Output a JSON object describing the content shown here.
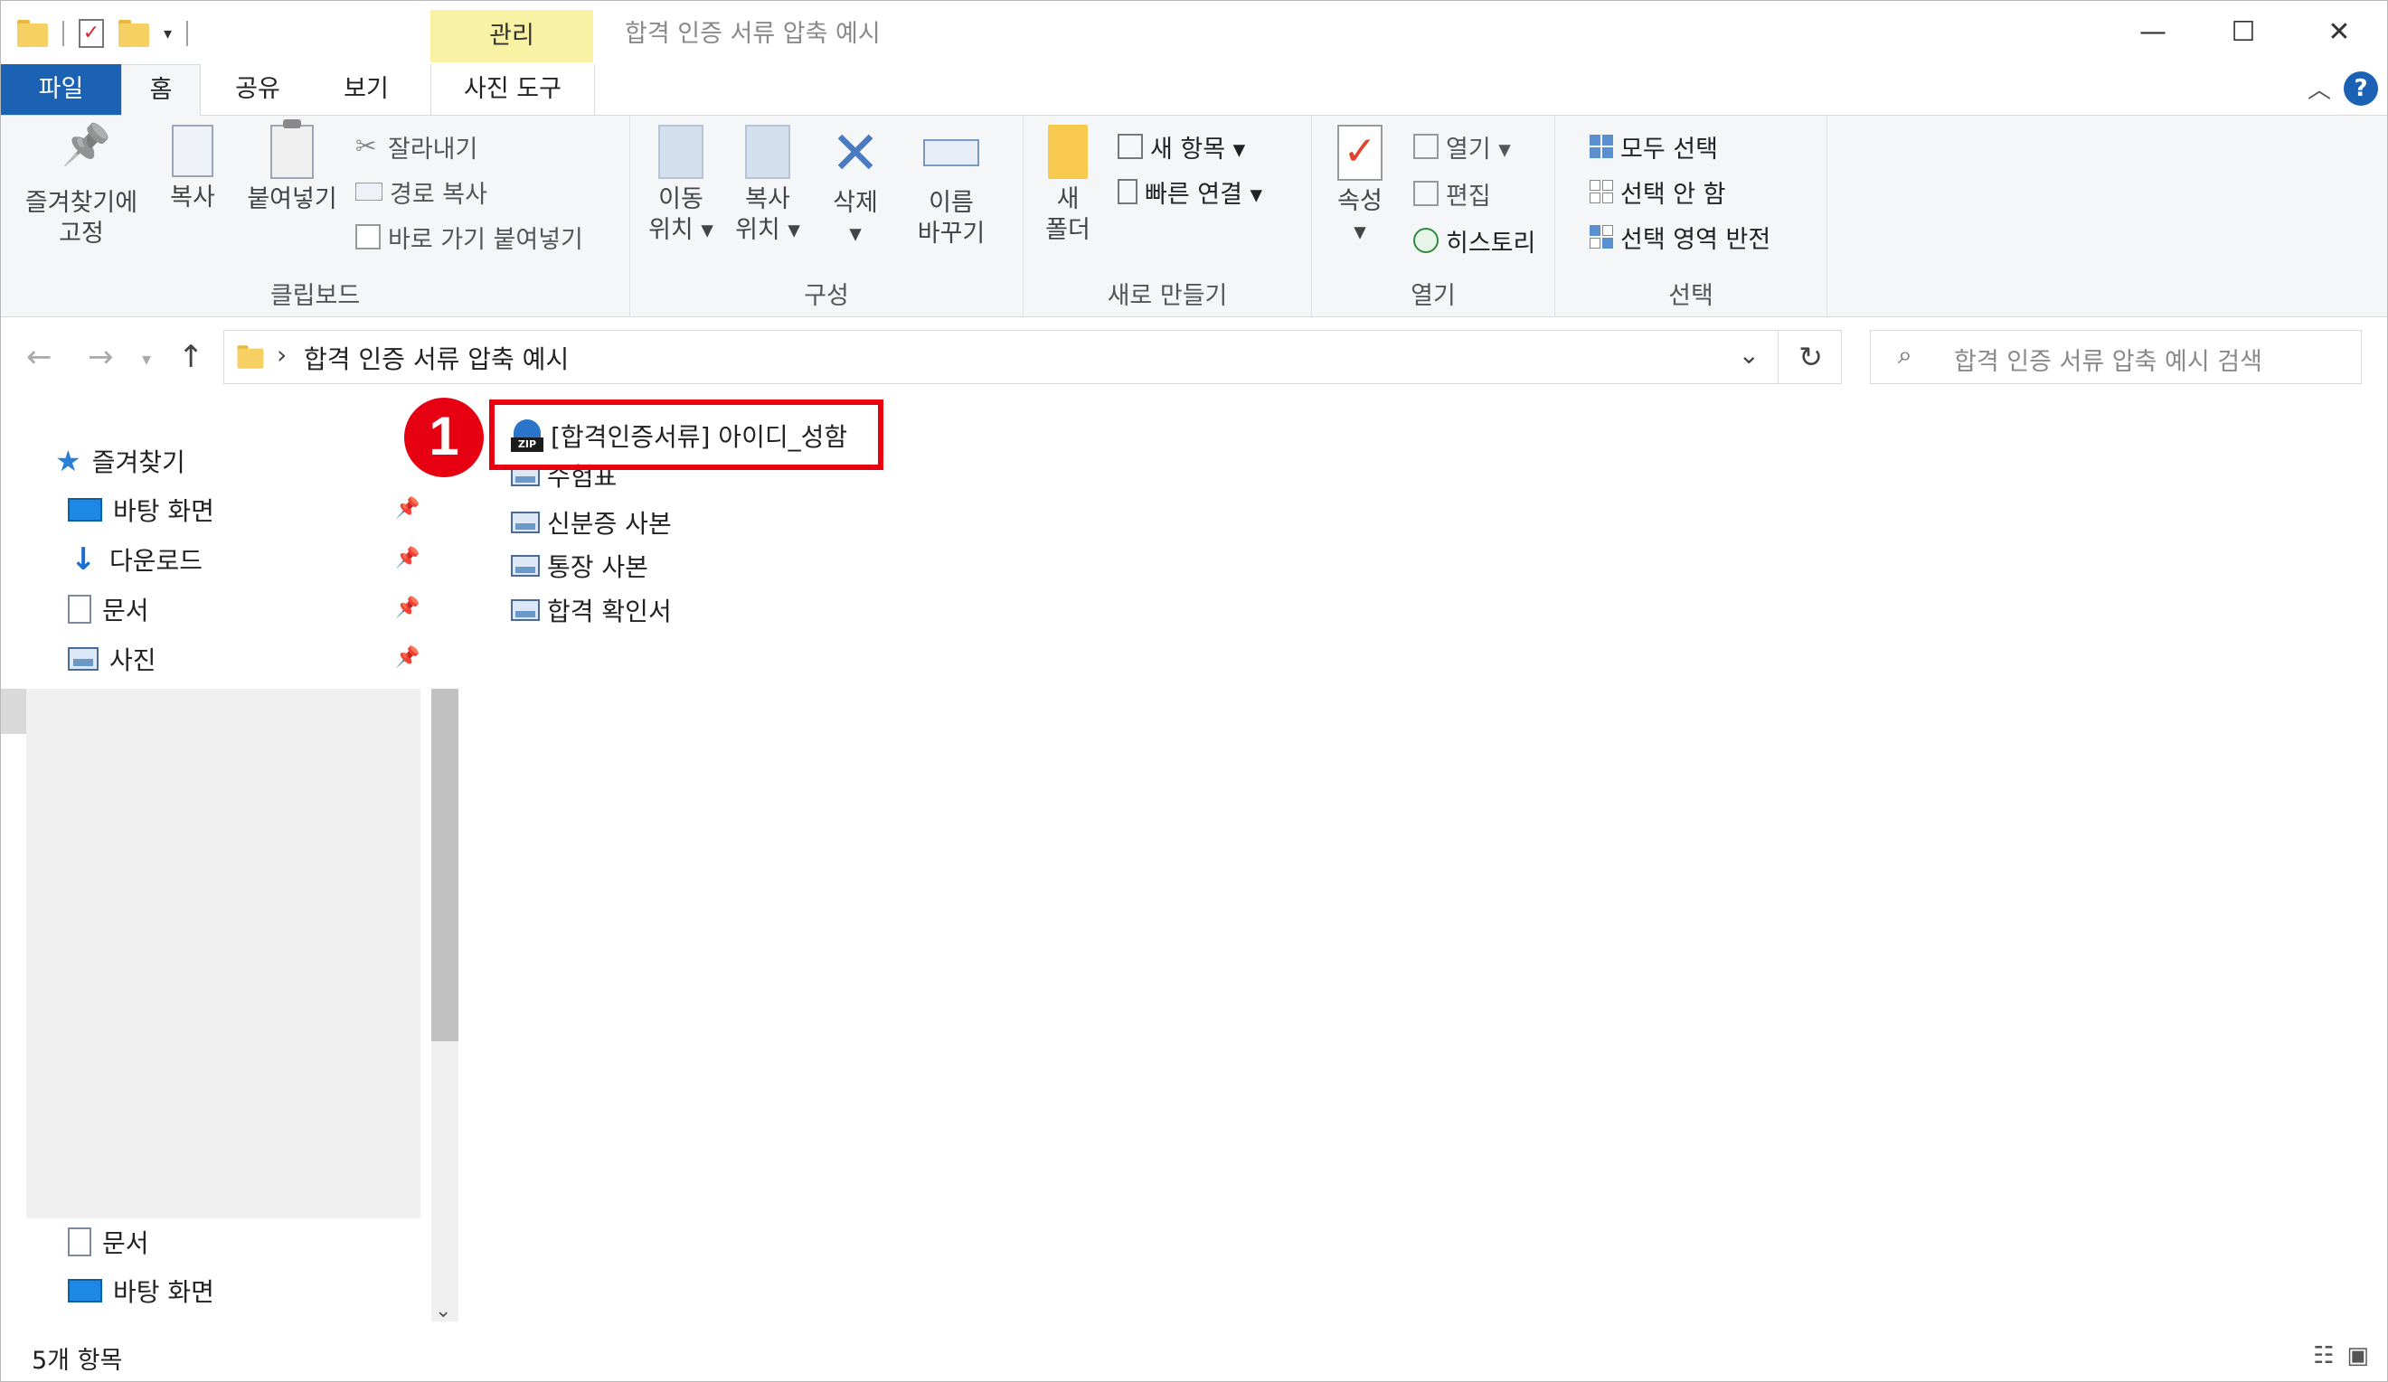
{
  "window": {
    "title": "합격 인증 서류 압축 예시",
    "context_tab": "관리"
  },
  "ribbon_tabs": [
    "파일",
    "홈",
    "공유",
    "보기",
    "사진 도구"
  ],
  "ribbon": {
    "clipboard": {
      "pin_line1": "즐겨찾기에",
      "pin_line2": "고정",
      "copy": "복사",
      "paste": "붙여넣기",
      "cut": "잘라내기",
      "copy_path": "경로 복사",
      "paste_shortcut": "바로 가기 붙여넣기",
      "label": "클립보드"
    },
    "organize": {
      "move1": "이동",
      "move2": "위치 ▾",
      "copyto1": "복사",
      "copyto2": "위치 ▾",
      "delete": "삭제",
      "rename1": "이름",
      "rename2": "바꾸기",
      "label": "구성"
    },
    "new": {
      "folder1": "새",
      "folder2": "폴더",
      "new_item": "새 항목 ▾",
      "easy_access": "빠른 연결 ▾",
      "label": "새로 만들기"
    },
    "open": {
      "properties": "속성",
      "open": "열기 ▾",
      "edit": "편집",
      "history": "히스토리",
      "label": "열기"
    },
    "select": {
      "select_all": "모두 선택",
      "select_none": "선택 안 함",
      "invert": "선택 영역 반전",
      "label": "선택"
    }
  },
  "address": {
    "path": "합격 인증 서류 압축 예시",
    "search_placeholder": "합격 인증 서류 압축 예시 검색"
  },
  "nav": {
    "quick_access": "즐겨찾기",
    "items": [
      "바탕 화면",
      "다운로드",
      "문서",
      "사진"
    ],
    "bottom_items": [
      "문서",
      "바탕 화면"
    ]
  },
  "files": [
    "[합격인증서류] 아이디_성함",
    "수험표",
    "신분증 사본",
    "통장 사본",
    "합격 확인서"
  ],
  "annotation": {
    "step": "1",
    "color": "#e60012"
  },
  "status": {
    "count": "5개 항목"
  }
}
